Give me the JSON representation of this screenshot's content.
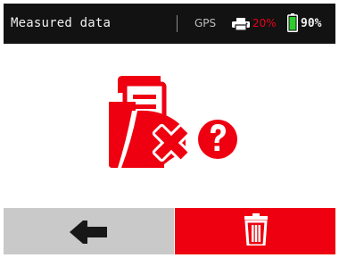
{
  "header": {
    "title": "Measured data",
    "gps_label": "GPS",
    "printer_level": "20%",
    "battery_level": "90%"
  },
  "icons": {
    "printer": "printer-icon",
    "battery": "battery-icon",
    "illustration": "folder-delete-question-icon",
    "back": "arrow-left-icon",
    "delete": "trash-icon"
  },
  "colors": {
    "accent_red": "#ee0010",
    "header_bg": "#121212",
    "back_button_bg": "#c9c9c9",
    "battery_green": "#2ecc2e"
  }
}
